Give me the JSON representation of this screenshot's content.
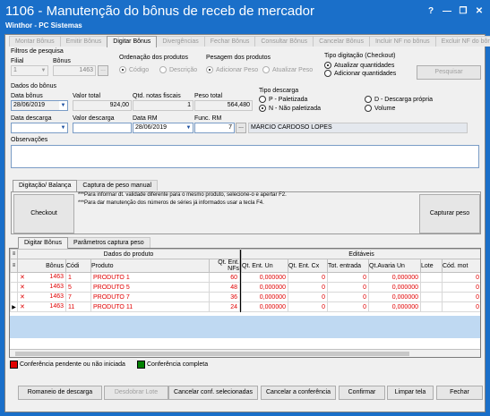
{
  "window": {
    "title": "1106 - Manutenção do bônus de receb de mercador",
    "subtitle": "Winthor - PC Sistemas",
    "help": "?",
    "minimize": "—",
    "restore": "❐",
    "close": "✕"
  },
  "main_tabs": [
    {
      "label": "Montar Bônus",
      "active": false
    },
    {
      "label": "Emitir Bônus",
      "active": false
    },
    {
      "label": "Digitar Bônus",
      "active": true
    },
    {
      "label": "Divergências",
      "active": false
    },
    {
      "label": "Fechar Bônus",
      "active": false
    },
    {
      "label": "Consultar Bônus",
      "active": false
    },
    {
      "label": "Cancelar Bônus",
      "active": false
    },
    {
      "label": "Incluir NF no bônus",
      "active": false
    },
    {
      "label": "Excluir NF do bônus",
      "active": false
    }
  ],
  "filters": {
    "group_label": "Filtros de pesquisa",
    "filial_label": "Filial",
    "filial_value": "1",
    "bonus_label": "Bônus",
    "bonus_value": "1463",
    "ordenacao_label": "Ordenação dos produtos",
    "ordenacao_options": [
      "Código",
      "Descrição"
    ],
    "pesagem_label": "Pesagem dos produtos",
    "pesagem_options": [
      "Adicionar Peso",
      "Atualizar Peso"
    ],
    "tipo_digitacao_label": "Tipo digitação (Checkout)",
    "tipo_digitacao_options": [
      "Atualizar quantidades",
      "Adicionar quantidades"
    ],
    "pesquisar_label": "Pesquisar"
  },
  "bonus_data": {
    "group_label": "Dados do bônus",
    "data_bonus_label": "Data bônus",
    "data_bonus_value": "28/06/2019",
    "valor_total_label": "Valor total",
    "valor_total_value": "924,00",
    "qtd_notas_label": "Qtd. notas fiscais",
    "qtd_notas_value": "1",
    "peso_total_label": "Peso total",
    "peso_total_value": "564,480",
    "data_descarga_label": "Data descarga",
    "data_descarga_value": "",
    "valor_descarga_label": "Valor descarga",
    "valor_descarga_value": "",
    "data_rm_label": "Data RM",
    "data_rm_value": "28/06/2019",
    "func_rm_label": "Func. RM",
    "func_rm_code": "7",
    "func_rm_name": "MÁRCIO CARDOSO LOPES",
    "tipo_descarga_label": "Tipo descarga",
    "tipo_descarga_options": [
      "P - Paletizada",
      "N - Não paletizada",
      "D - Descarga própria",
      "Volume"
    ],
    "observacoes_label": "Observações",
    "observacoes_value": ""
  },
  "sub_tabs": [
    {
      "label": "Digitação/ Balança",
      "active": true
    },
    {
      "label": "Captura de peso manual",
      "active": false
    }
  ],
  "checkout": {
    "button_label": "Checkout",
    "hint1": "***Para informar dt. validade diferente para o mesmo produto, selecione-o e apertar F2.",
    "hint2": "***Para dar manutenção dos números de séries já informados  usar a tecla F4.",
    "capturar_label": "Capturar peso"
  },
  "grid_tabs": [
    {
      "label": "Digitar Bônus",
      "active": true
    },
    {
      "label": "Parâmetros captura peso",
      "active": false
    }
  ],
  "grid": {
    "group_produto": "Dados do produto",
    "group_editaveis": "Editáveis",
    "columns": [
      "Bônus",
      "Códi",
      "Produto",
      "Qt. Ent. NFs",
      "Qt. Ent. Un",
      "Qt. Ent. Cx",
      "Tot. entrada",
      "Qt.Avaria Un",
      "Lote",
      "Cód. mot"
    ],
    "rows": [
      {
        "bonus": "1463",
        "codigo": "1",
        "produto": "PRODUTO 1",
        "qt_nfs": "60",
        "qt_un": "0,000000",
        "qt_cx": "0",
        "tot": "0",
        "avaria": "0,000000",
        "lote": "",
        "cod_mot": "0",
        "current": false
      },
      {
        "bonus": "1463",
        "codigo": "5",
        "produto": "PRODUTO 5",
        "qt_nfs": "48",
        "qt_un": "0,000000",
        "qt_cx": "0",
        "tot": "0",
        "avaria": "0,000000",
        "lote": "",
        "cod_mot": "0",
        "current": false
      },
      {
        "bonus": "1463",
        "codigo": "7",
        "produto": "PRODUTO 7",
        "qt_nfs": "36",
        "qt_un": "0,000000",
        "qt_cx": "0",
        "tot": "0",
        "avaria": "0,000000",
        "lote": "",
        "cod_mot": "0",
        "current": false
      },
      {
        "bonus": "1463",
        "codigo": "11",
        "produto": "PRODUTO 11",
        "qt_nfs": "24",
        "qt_un": "0,000000",
        "qt_cx": "0",
        "tot": "0",
        "avaria": "0,000000",
        "lote": "",
        "cod_mot": "0",
        "current": true
      }
    ]
  },
  "legend": {
    "pending_label": "Conferência pendente ou não iniciada",
    "pending_color": "#e00000",
    "complete_label": "Conferência completa",
    "complete_color": "#008000"
  },
  "footer_buttons": [
    {
      "label": "Romaneio de descarga",
      "enabled": true
    },
    {
      "label": "Desdobrar Lote",
      "enabled": false
    },
    {
      "label": "Cancelar conf. selecionadas",
      "enabled": true
    },
    {
      "label": "Cancelar a conferência",
      "enabled": true
    },
    {
      "label": "Confirmar",
      "enabled": true
    },
    {
      "label": "Limpar tela",
      "enabled": true
    },
    {
      "label": "Fechar",
      "enabled": true
    }
  ]
}
